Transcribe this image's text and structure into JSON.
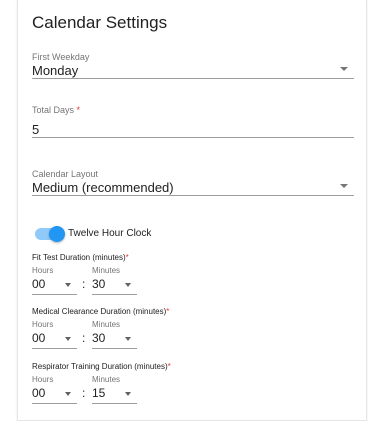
{
  "title": "Calendar Settings",
  "first_weekday": {
    "label": "First Weekday",
    "value": "Monday"
  },
  "total_days": {
    "label": "Total Days",
    "required_mark": "*",
    "value": "5"
  },
  "calendar_layout": {
    "label": "Calendar Layout",
    "value": "Medium (recommended)"
  },
  "twelve_hour_clock": {
    "label": "Twelve Hour Clock",
    "enabled": true
  },
  "durations": [
    {
      "label": "Fit Test Duration (minutes)",
      "required_mark": "*",
      "hours_label": "Hours",
      "minutes_label": "Minutes",
      "separator": ":",
      "hours": "00",
      "minutes": "30"
    },
    {
      "label": "Medical Clearance Duration (minutes)",
      "required_mark": "*",
      "hours_label": "Hours",
      "minutes_label": "Minutes",
      "separator": ":",
      "hours": "00",
      "minutes": "30"
    },
    {
      "label": "Respirator Training Duration (minutes)",
      "required_mark": "*",
      "hours_label": "Hours",
      "minutes_label": "Minutes",
      "separator": ":",
      "hours": "00",
      "minutes": "15"
    }
  ],
  "colors": {
    "accent": "#2196f3",
    "accent_track": "#90caf9",
    "required": "#e53935"
  },
  "icons": {
    "dropdown": "caret-down-icon"
  }
}
